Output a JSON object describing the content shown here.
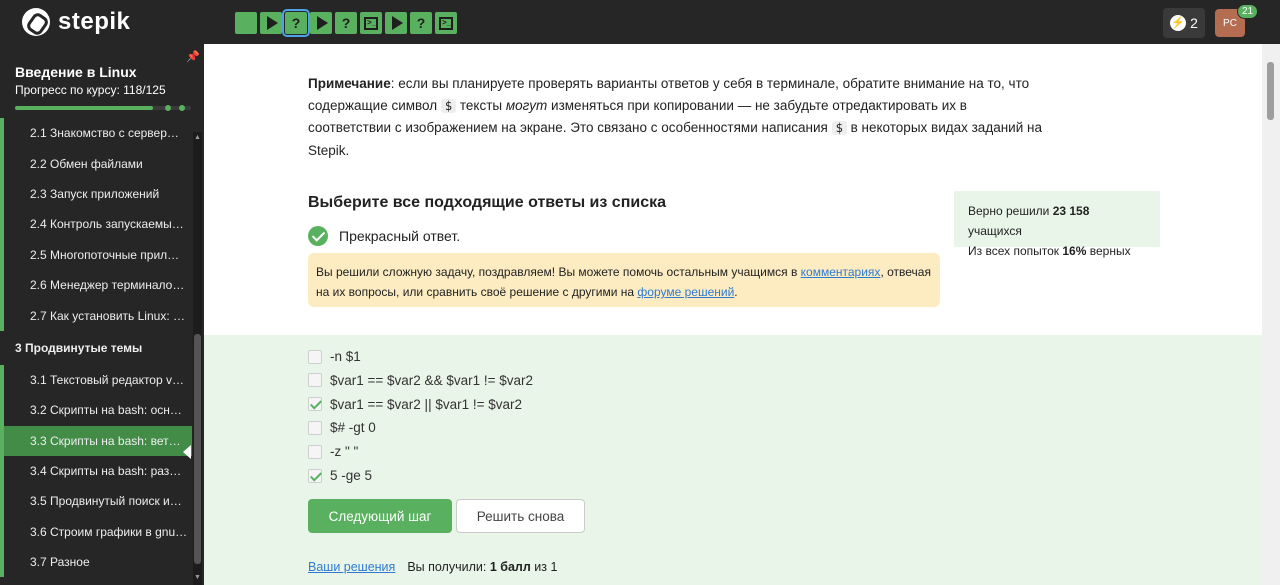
{
  "topbar": {
    "logo_text": "stepik",
    "steps": [
      {
        "type": "text",
        "current": false
      },
      {
        "type": "video",
        "current": false
      },
      {
        "type": "quiz",
        "current": true
      },
      {
        "type": "video",
        "current": false
      },
      {
        "type": "quiz",
        "current": false
      },
      {
        "type": "terminal",
        "current": false
      },
      {
        "type": "video",
        "current": false
      },
      {
        "type": "quiz",
        "current": false
      },
      {
        "type": "terminal",
        "current": false
      }
    ],
    "energy_count": "2",
    "avatar_initials": "PC",
    "notification_count": "21"
  },
  "sidebar": {
    "course_title": "Введение в Linux",
    "progress_label": "Прогресс по курсу:",
    "progress_value": "118/125",
    "progress_fraction": 0.944,
    "items": [
      {
        "label": "2.1  Знакомство с сервер…",
        "kind": "lesson",
        "active": false
      },
      {
        "label": "2.2  Обмен файлами",
        "kind": "lesson",
        "active": false
      },
      {
        "label": "2.3  Запуск приложений",
        "kind": "lesson",
        "active": false
      },
      {
        "label": "2.4  Контроль запускаемы…",
        "kind": "lesson",
        "active": false
      },
      {
        "label": "2.5  Многопоточные прил…",
        "kind": "lesson",
        "active": false
      },
      {
        "label": "2.6  Менеджер терминало…",
        "kind": "lesson",
        "active": false
      },
      {
        "label": "2.7  Как установить Linux: …",
        "kind": "lesson",
        "active": false
      },
      {
        "label": "3  Продвинутые темы",
        "kind": "section",
        "active": false
      },
      {
        "label": "3.1  Текстовый редактор v…",
        "kind": "lesson",
        "active": false
      },
      {
        "label": "3.2  Скрипты на bash: осн…",
        "kind": "lesson",
        "active": false
      },
      {
        "label": "3.3  Скрипты на bash: вет…",
        "kind": "lesson",
        "active": true
      },
      {
        "label": "3.4  Скрипты на bash: раз…",
        "kind": "lesson",
        "active": false
      },
      {
        "label": "3.5  Продвинутый поиск и…",
        "kind": "lesson",
        "active": false
      },
      {
        "label": "3.6  Строим графики в gnu…",
        "kind": "lesson",
        "active": false
      },
      {
        "label": "3.7  Разное",
        "kind": "lesson",
        "active": false
      }
    ]
  },
  "note": {
    "bold": "Примечание",
    "p1": ": если вы планируете проверять варианты ответов у себя в терминале, обратите внимание на то, что содержащие символ ",
    "code": "$",
    "p2": " тексты ",
    "em": "могут",
    "p3": " изменяться при копировании — не забудьте отредактировать их в соответствии с изображением на экране. Это связано с особенностями написания ",
    "p4": " в некоторых видах заданий на Stepik."
  },
  "question": {
    "title": "Выберите все подходящие ответы из списка",
    "result": "Прекрасный ответ."
  },
  "stats": {
    "line1_prefix": "Верно решили ",
    "line1_value": "23 158",
    "line1_suffix": " учащихся",
    "line2_prefix": "Из всех попыток ",
    "line2_value": "16%",
    "line2_suffix": " верных"
  },
  "congrats": {
    "p1": "Вы решили сложную задачу, поздравляем! Вы можете помочь остальным учащимся в ",
    "link1": "комментариях",
    "p2": ", отвечая на их вопросы, или сравнить своё решение с другими на ",
    "link2": "форуме решений",
    "p3": "."
  },
  "options": [
    {
      "label": "-n $1",
      "checked": false
    },
    {
      "label": "$var1 == $var2 && $var1 != $var2",
      "checked": false
    },
    {
      "label": "$var1 == $var2 || $var1 != $var2",
      "checked": true
    },
    {
      "label": "$# -gt 0",
      "checked": false
    },
    {
      "label": "-z \" \"",
      "checked": false
    },
    {
      "label": "5 -ge 5",
      "checked": true
    }
  ],
  "buttons": {
    "next": "Следующий шаг",
    "retry": "Решить снова"
  },
  "footer": {
    "solutions_link": "Ваши решения",
    "score_prefix": "Вы получили: ",
    "score_value": "1 балл",
    "score_suffix": " из 1"
  },
  "colors": {
    "accent": "#59b15f",
    "topbar": "#262626",
    "link": "#2e7bcf",
    "congrats_bg": "#fdecc2",
    "options_bg": "#e9f5e9"
  }
}
